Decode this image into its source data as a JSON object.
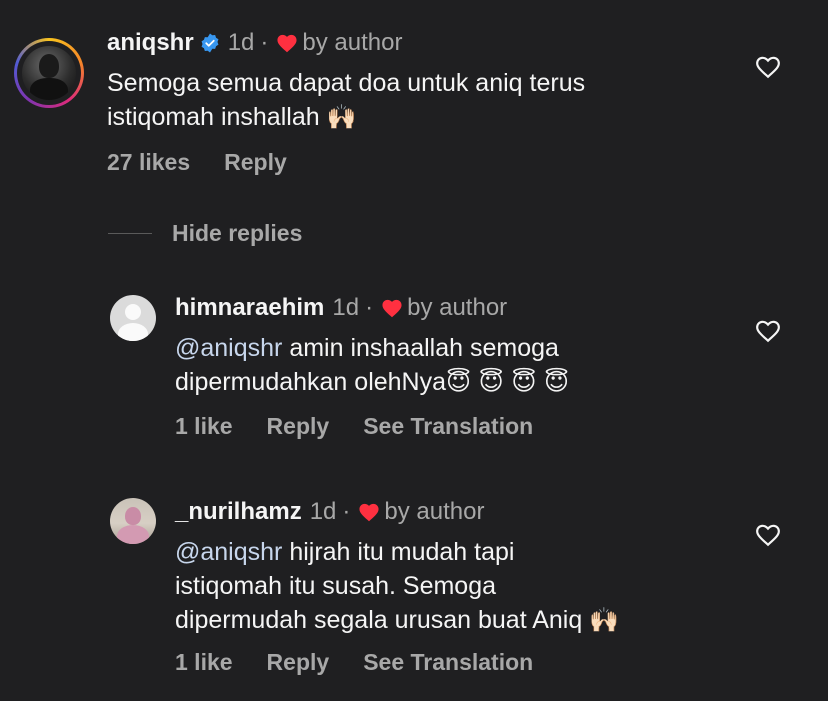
{
  "comments": [
    {
      "username": "aniqshr",
      "time": "1d",
      "by_author": "by author",
      "lines": [
        "Semoga semua dapat doa untuk aniq terus",
        "istiqomah inshallah"
      ],
      "emoji": "🙌🏻",
      "likes": "27 likes",
      "reply": "Reply"
    },
    {
      "username": "himnaraehim",
      "time": "1d",
      "by_author": "by author",
      "mention": "@aniqshr",
      "line1_rest": " amin inshaallah semoga",
      "line2": "dipermudahkan olehNya",
      "emoji": "😇 😇 😇 😇",
      "likes": "1 like",
      "reply": "Reply",
      "translate": "See Translation"
    },
    {
      "username": "_nurilhamz",
      "time": "1d",
      "by_author": "by author",
      "mention": "@aniqshr",
      "line1_rest": " hijrah itu mudah tapi",
      "line2": "istiqomah itu susah. Semoga",
      "line3": "dipermudah segala urusan buat Aniq",
      "emoji": "🙌🏻",
      "likes": "1 like",
      "reply": "Reply",
      "translate": "See Translation"
    }
  ],
  "hide_replies": "Hide replies",
  "colors": {
    "background": "#1f1f21",
    "verified": "#3897f0",
    "heart": "#ff3040",
    "secondary_text": "#a8a8a8"
  },
  "icons": [
    "verified-badge-icon",
    "heart-filled-icon",
    "heart-outline-icon",
    "avatar-icon"
  ]
}
